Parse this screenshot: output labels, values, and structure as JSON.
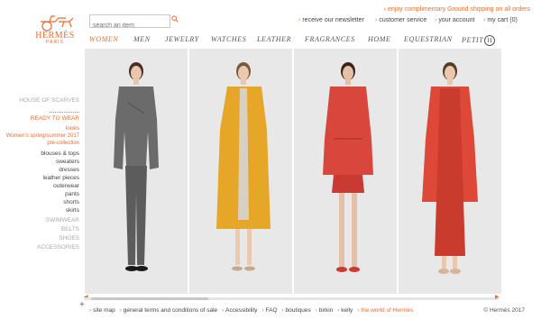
{
  "brand": {
    "name": "HERMÈS",
    "city": "PARIS"
  },
  "search": {
    "placeholder": "search an item"
  },
  "promo": {
    "text": "enjoy complimentary Ground shipping on all orders"
  },
  "utility": {
    "newsletter": "receive our newsletter",
    "service": "customer service",
    "account": "your account",
    "cart": "my cart (0)"
  },
  "nav": [
    "WOMEN",
    "MEN",
    "JEWELRY",
    "WATCHES",
    "LEATHER",
    "FRAGRANCES",
    "HOME",
    "EQUESTRIAN",
    "PETIT"
  ],
  "nav_badge": "h",
  "sidebar": {
    "house_of_scarves": "HOUSE OF SCARVES",
    "ready_to_wear": "READY TO WEAR",
    "looks": "looks",
    "collection_line1": "Women's spring/summer 2017",
    "collection_line2": "pre-collection",
    "categories": [
      "blouses & tops",
      "sweaters",
      "dresses",
      "leather pieces",
      "outerwear",
      "pants",
      "shorts",
      "skirts"
    ],
    "other": [
      "SWIMWEAR",
      "BELTS",
      "SHOES",
      "ACCESSORIES"
    ]
  },
  "panels": [
    {
      "label": "grey check jacket and trousers",
      "outfit": "#6b6b6b",
      "skin": "#e9c7ae",
      "hair": "#4a2e22",
      "shoe": "#1a1a1a"
    },
    {
      "label": "yellow coat",
      "outfit": "#e6a728",
      "skin": "#eac9b0",
      "hair": "#7a5a3c",
      "shoe": "#c9a68a"
    },
    {
      "label": "red shirt jacket and skirt",
      "outfit": "#d9463b",
      "skin": "#e6c0a6",
      "hair": "#3a2418",
      "shoe": "#c93a33"
    },
    {
      "label": "red cardigan and dress",
      "outfit": "#dd4838",
      "skin": "#ebc7ad",
      "hair": "#5a3a28",
      "shoe": "#d8b39c"
    }
  ],
  "footer": {
    "links": [
      "site map",
      "general terms and conditions of sale",
      "Accessibility",
      "FAQ",
      "boutiques",
      "birkin",
      "kelly",
      "the world of Hermès"
    ],
    "copyright": "© Hermès 2017"
  },
  "colors": {
    "accent": "#f26b25",
    "panel_bg": "#e8e8e8"
  }
}
